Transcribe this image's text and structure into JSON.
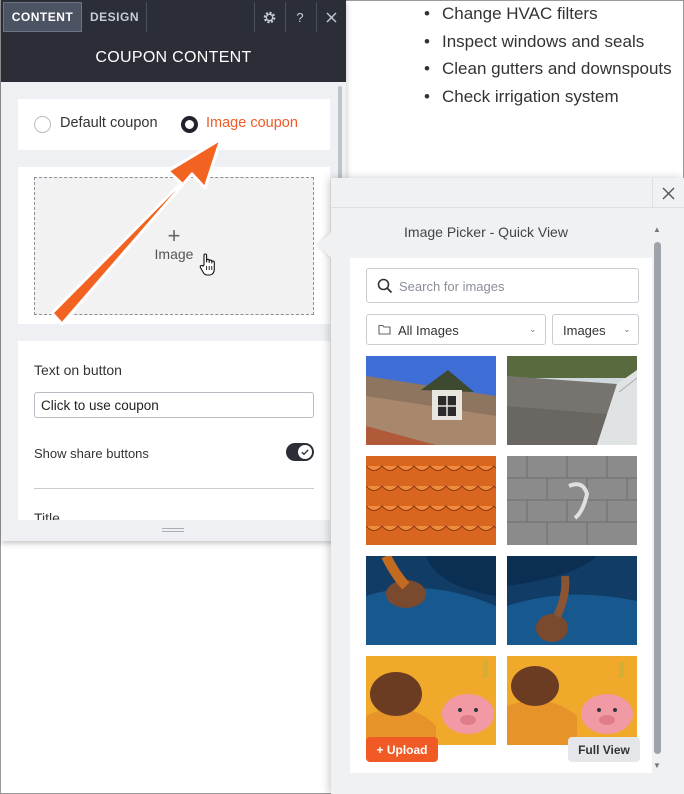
{
  "background_list": [
    "Change HVAC filters",
    "Inspect windows and seals",
    "Clean gutters and downspouts",
    "Check irrigation system"
  ],
  "panel": {
    "tabs": {
      "content": "CONTENT",
      "design": "DESIGN"
    },
    "help_label": "?",
    "title": "COUPON CONTENT",
    "radio": {
      "default_label": "Default coupon",
      "image_label": "Image coupon",
      "selected": "image"
    },
    "image_drop": {
      "plus": "+",
      "label": "Image"
    },
    "button_text_label": "Text on button",
    "button_text_value": "Click to use coupon",
    "share_label": "Show share buttons",
    "share_enabled": true,
    "title_label": "Title"
  },
  "picker": {
    "title": "Image Picker - Quick View",
    "search_placeholder": "Search for images",
    "folder_select": "All Images",
    "type_select": "Images",
    "upload_label": "+ Upload",
    "fullview_label": "Full View",
    "accent_color": "#f15a24"
  }
}
